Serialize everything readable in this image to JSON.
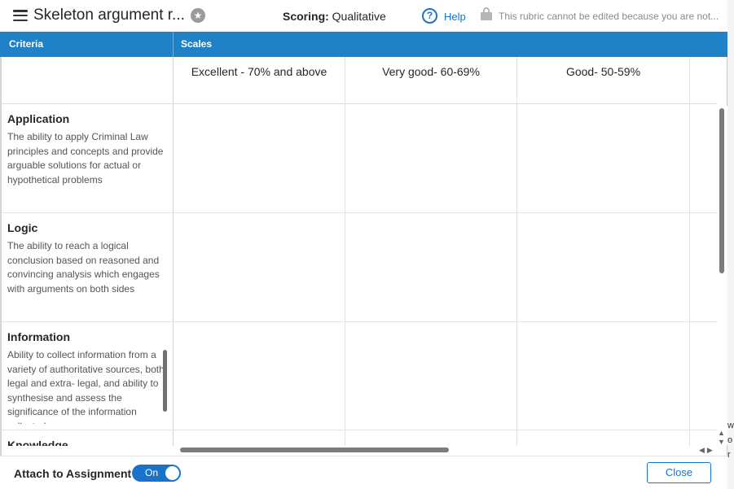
{
  "header": {
    "title": "Skeleton argument r...",
    "scoring_label": "Scoring:",
    "scoring_value": "Qualitative",
    "help_label": "Help",
    "lock_message": "This rubric cannot be edited because you are not..."
  },
  "table": {
    "criteria_header": "Criteria",
    "scales_header": "Scales",
    "scales": [
      "Excellent - 70% and above",
      "Very good- 60-69%",
      "Good- 50-59%"
    ],
    "criteria": [
      {
        "name": "Application",
        "description": "The ability to apply Criminal Law principles and concepts and provide arguable solutions for actual or hypothetical problems"
      },
      {
        "name": "Logic",
        "description": "The ability to reach a logical conclusion based on reasoned and convincing analysis which engages with arguments on both sides"
      },
      {
        "name": "Information",
        "description": "Ability to collect information from a variety of authoritative sources, both legal and extra- legal, and ability to synthesise and assess the significance of the information collected"
      },
      {
        "name": "Knowledge",
        "description": ""
      }
    ]
  },
  "footer": {
    "attach_label": "Attach to Assignment",
    "toggle_label": "On",
    "close_label": "Close"
  },
  "backdrop": {
    "fragments": [
      "w",
      "o",
      "r"
    ]
  },
  "colors": {
    "accent": "#1f82c8",
    "link": "#1a73c9"
  }
}
